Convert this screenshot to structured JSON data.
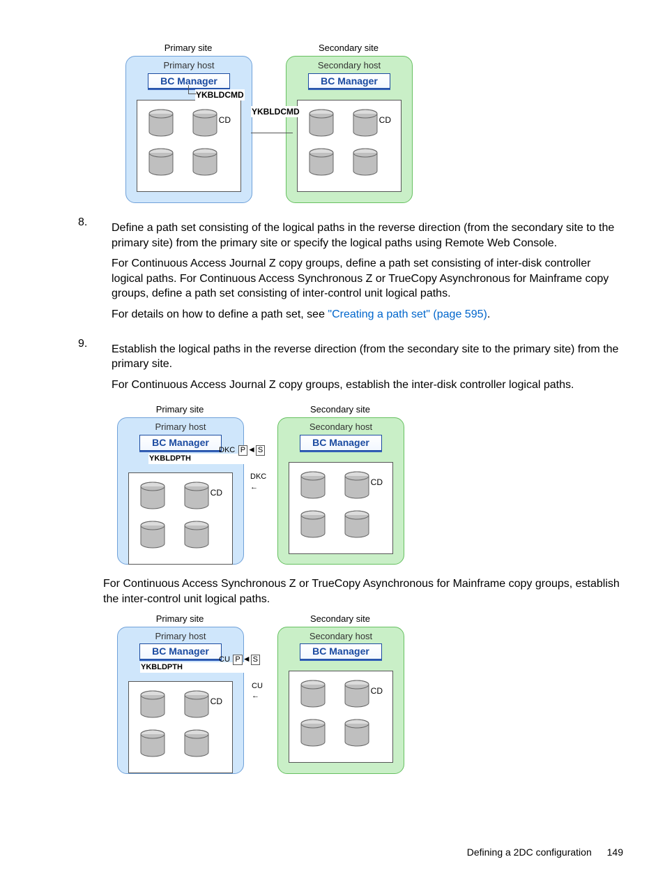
{
  "step8": {
    "num": "8.",
    "p1": "Define a path set consisting of the logical paths in the reverse direction (from the secondary site to the primary site) from the primary site or specify the logical paths using Remote Web Console.",
    "p2": "For Continuous Access Journal Z copy groups, define a path set consisting of inter-disk controller logical paths. For Continuous Access Synchronous Z or TrueCopy Asynchronous for Mainframe copy groups, define a path set consisting of inter-control unit logical paths.",
    "p3a": "For details on how to define a path set, see ",
    "p3link": "\"Creating a path set\" (page 595)",
    "p3b": "."
  },
  "step9": {
    "num": "9.",
    "p1": "Establish the logical paths in the reverse direction (from the secondary site to the primary site) from the primary site.",
    "p2": "For Continuous Access Journal Z copy groups, establish the inter-disk controller logical paths."
  },
  "mid_para": "For Continuous Access Synchronous Z or TrueCopy Asynchronous for Mainframe copy groups, establish the inter-control unit logical paths.",
  "dg": {
    "primary_site": "Primary site",
    "secondary_site": "Secondary site",
    "primary_host": "Primary host",
    "secondary_host": "Secondary host",
    "bc_manager": "BC Manager",
    "cd": "CD",
    "ykbldcmd": "YKBLDCMD",
    "ykbldpth": "YKBLDPTH",
    "dkc": "DKC",
    "cu": "CU",
    "p": "P",
    "s": "S"
  },
  "footer": {
    "label": "Defining a 2DC configuration",
    "page": "149"
  }
}
